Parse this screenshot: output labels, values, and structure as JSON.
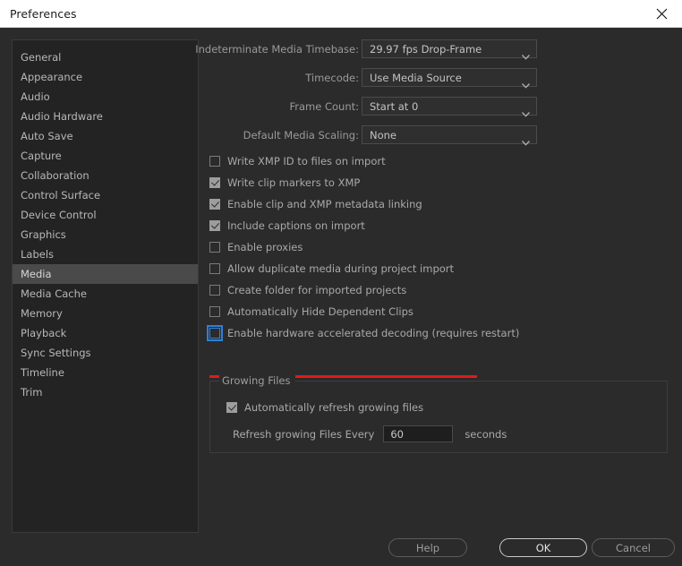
{
  "window": {
    "title": "Preferences",
    "close_icon": "close-icon"
  },
  "sidebar": {
    "items": [
      {
        "label": "General",
        "selected": false
      },
      {
        "label": "Appearance",
        "selected": false
      },
      {
        "label": "Audio",
        "selected": false
      },
      {
        "label": "Audio Hardware",
        "selected": false
      },
      {
        "label": "Auto Save",
        "selected": false
      },
      {
        "label": "Capture",
        "selected": false
      },
      {
        "label": "Collaboration",
        "selected": false
      },
      {
        "label": "Control Surface",
        "selected": false
      },
      {
        "label": "Device Control",
        "selected": false
      },
      {
        "label": "Graphics",
        "selected": false
      },
      {
        "label": "Labels",
        "selected": false
      },
      {
        "label": "Media",
        "selected": true
      },
      {
        "label": "Media Cache",
        "selected": false
      },
      {
        "label": "Memory",
        "selected": false
      },
      {
        "label": "Playback",
        "selected": false
      },
      {
        "label": "Sync Settings",
        "selected": false
      },
      {
        "label": "Timeline",
        "selected": false
      },
      {
        "label": "Trim",
        "selected": false
      }
    ]
  },
  "fields": [
    {
      "label": "Indeterminate Media Timebase:",
      "value": "29.97 fps Drop-Frame"
    },
    {
      "label": "Timecode:",
      "value": "Use Media Source"
    },
    {
      "label": "Frame Count:",
      "value": "Start at 0"
    },
    {
      "label": "Default Media Scaling:",
      "value": "None"
    }
  ],
  "checkboxes": [
    {
      "label": "Write XMP ID to files on import",
      "checked": false,
      "focused": false
    },
    {
      "label": "Write clip markers to XMP",
      "checked": true,
      "focused": false
    },
    {
      "label": "Enable clip and XMP metadata linking",
      "checked": true,
      "focused": false
    },
    {
      "label": "Include captions on import",
      "checked": true,
      "focused": false
    },
    {
      "label": "Enable proxies",
      "checked": false,
      "focused": false
    },
    {
      "label": "Allow duplicate media during project import",
      "checked": false,
      "focused": false
    },
    {
      "label": "Create folder for imported projects",
      "checked": false,
      "focused": false
    },
    {
      "label": "Automatically Hide Dependent Clips",
      "checked": false,
      "focused": false
    },
    {
      "label": "Enable hardware accelerated decoding (requires restart)",
      "checked": false,
      "focused": true
    }
  ],
  "annotation": {
    "color": "#e01b1b",
    "target": "Enable hardware accelerated decoding (requires restart)"
  },
  "growing_files": {
    "title": "Growing Files",
    "auto_refresh_label": "Automatically refresh growing files",
    "auto_refresh_checked": true,
    "refresh_label": "Refresh growing Files Every",
    "refresh_value": "60",
    "seconds_label": "seconds"
  },
  "footer": {
    "help_label": "Help",
    "ok_label": "OK",
    "cancel_label": "Cancel"
  },
  "colors": {
    "accent_focus": "#2f7fd8",
    "annotation": "#e01b1b",
    "dialog_bg": "#2b2b2b",
    "sidebar_bg": "#232323",
    "selected_row": "#4a4a4a",
    "titlebar_bg": "#ffffff"
  }
}
